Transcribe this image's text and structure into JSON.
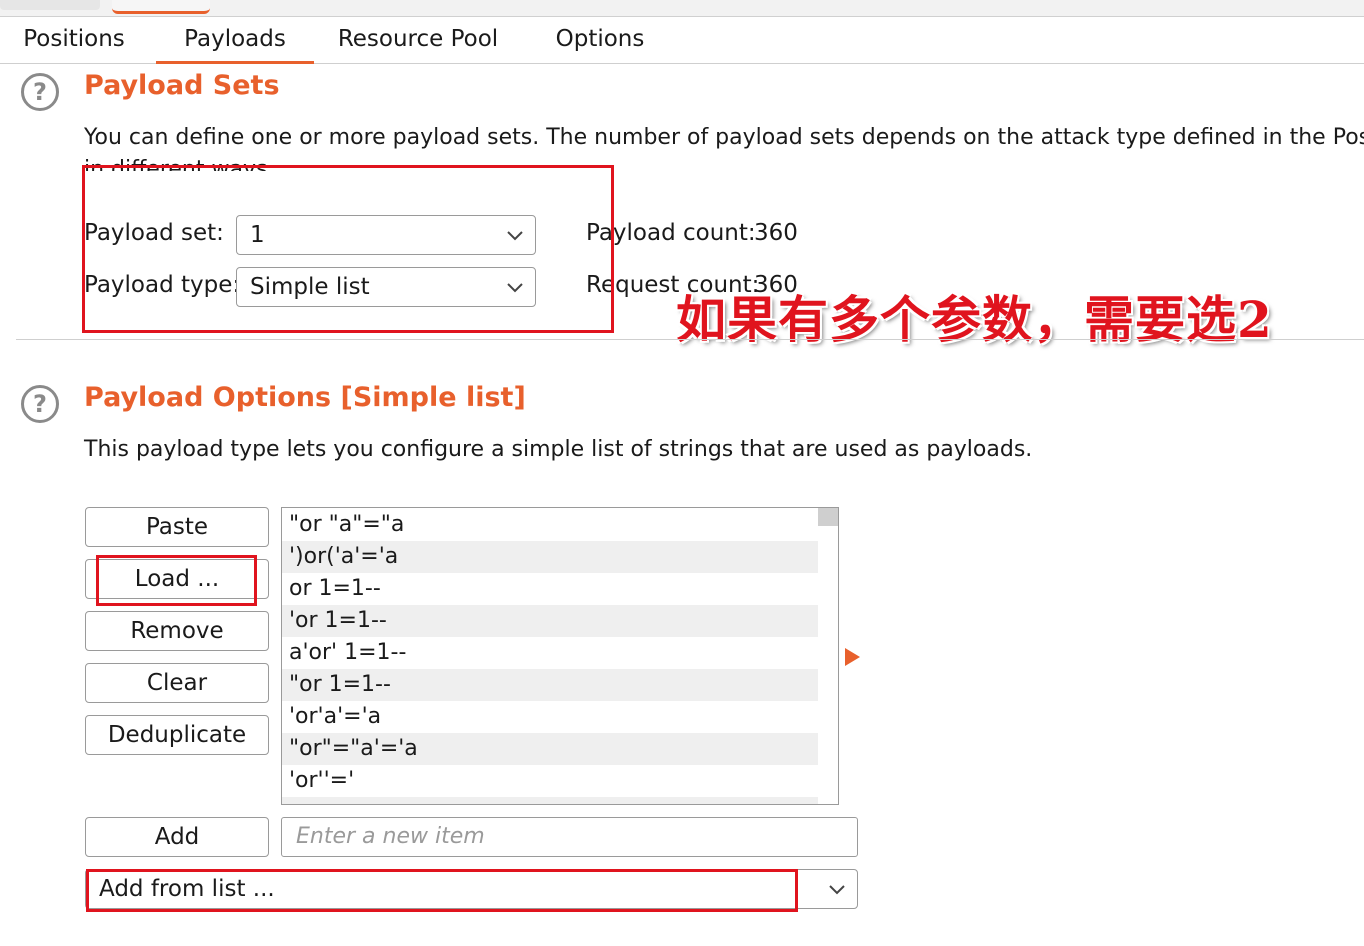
{
  "tabs": [
    "Positions",
    "Payloads",
    "Resource Pool",
    "Options"
  ],
  "active_tab": "Payloads",
  "payload_sets": {
    "title": "Payload Sets",
    "description_line1": "You can define one or more payload sets. The number of payload sets depends on the attack type defined in the Positior",
    "description_line2": "in different ways.",
    "payload_set_label": "Payload set:",
    "payload_set_value": "1",
    "payload_type_label": "Payload type:",
    "payload_type_value": "Simple list",
    "payload_count_label": "Payload count:",
    "payload_count_value": "360",
    "request_count_label": "Request count:",
    "request_count_value": "360"
  },
  "annotation": "如果有多个参数，需要选2",
  "payload_options": {
    "title": "Payload Options [Simple list]",
    "description": "This payload type lets you configure a simple list of strings that are used as payloads.",
    "buttons": {
      "paste": "Paste",
      "load": "Load ...",
      "remove": "Remove",
      "clear": "Clear",
      "deduplicate": "Deduplicate",
      "add": "Add"
    },
    "items": [
      "\"or \"a\"=\"a",
      "')or('a'='a",
      "or 1=1--",
      "'or 1=1--",
      "a'or' 1=1--",
      "\"or 1=1--",
      "'or'a'='a",
      "\"or\"=\"a'='a",
      "'or''='"
    ],
    "new_item_placeholder": "Enter a new item",
    "add_from_list": "Add from list ..."
  },
  "colors": {
    "accent": "#e8602c",
    "annotation_red": "#e0141e"
  }
}
